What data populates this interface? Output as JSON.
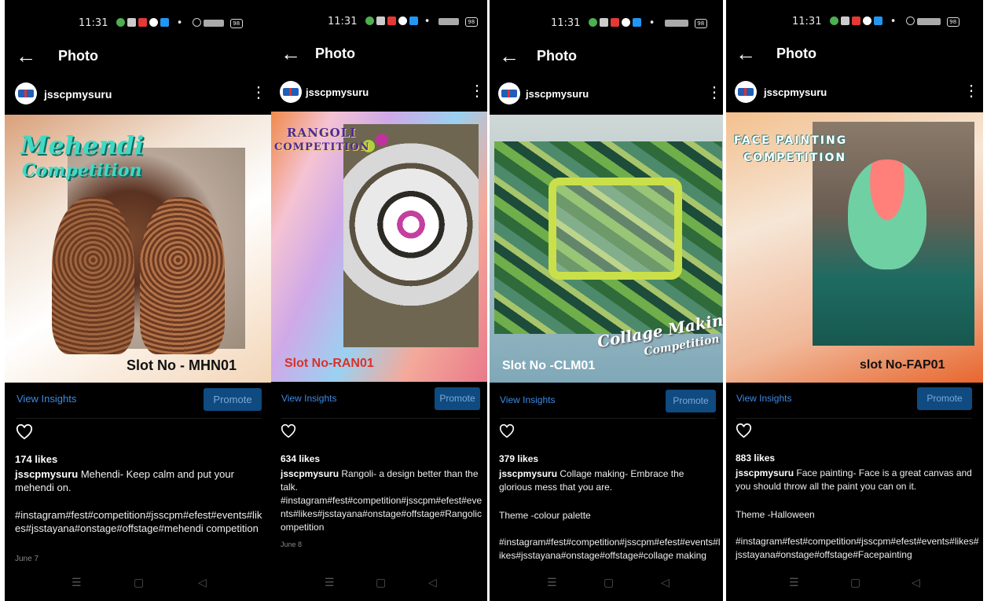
{
  "screens": [
    {
      "time": "11:31",
      "battery": "98",
      "title": "Photo",
      "username": "jsscpmysuru",
      "post_heading_line1": "Mehendi",
      "post_heading_line2": "Competition",
      "slot": "Slot No - MHN01",
      "view_insights": "View Insights",
      "promote": "Promote",
      "likes": "174 likes",
      "caption_user": "jsscpmysuru",
      "caption_text": "Mehendi- Keep calm and put your mehendi on.",
      "theme": "",
      "hashtags": "#instagram#fest#competition#jsscpm#efest#events#likes#jsstayana#onstage#offstage#mehendi competition",
      "date": "June 7"
    },
    {
      "time": "11:31",
      "battery": "98",
      "title": "Photo",
      "username": "jsscpmysuru",
      "post_heading_line1": "Rangoli",
      "post_heading_line2": "competition",
      "slot": "Slot No-RAN01",
      "view_insights": "View Insights",
      "promote": "Promote",
      "likes": "634 likes",
      "caption_user": "jsscpmysuru",
      "caption_text": "Rangoli- a design better than the talk.",
      "theme": "",
      "hashtags": "#instagram#fest#competition#jsscpm#efest#events#likes#jsstayana#onstage#offstage#Rangolicompetition",
      "date": "June 8"
    },
    {
      "time": "11:31",
      "battery": "98",
      "title": "Photo",
      "username": "jsscpmysuru",
      "post_heading_line1": "Collage Making",
      "post_heading_line2": "Competition",
      "slot": "Slot No -CLM01",
      "view_insights": "View Insights",
      "promote": "Promote",
      "likes": "379 likes",
      "caption_user": "jsscpmysuru",
      "caption_text": "Collage making- Embrace the glorious mess that you are.",
      "theme": "Theme -colour palette",
      "hashtags": "#instagram#fest#competition#jsscpm#efest#events#likes#jsstayana#onstage#offstage#collage making",
      "date": ""
    },
    {
      "time": "11:31",
      "battery": "98",
      "title": "Photo",
      "username": "jsscpmysuru",
      "post_heading_line1": "Face painting",
      "post_heading_line2": "competition",
      "slot": "slot No-FAP01",
      "view_insights": "View Insights",
      "promote": "Promote",
      "likes": "883 likes",
      "caption_user": "jsscpmysuru",
      "caption_text": "Face painting- Face is a great canvas and you should throw all the paint you can on it.",
      "theme": "Theme -Halloween",
      "hashtags": "#instagram#fest#competition#jsscpm#efest#events#likes#jsstayana#onstage#offstage#Facepainting",
      "date": ""
    }
  ],
  "icons": {
    "back": "arrow-left-icon",
    "more": "more-vertical-icon",
    "like": "heart-icon",
    "nav": [
      "menu-icon",
      "home-square-icon",
      "back-triangle-icon"
    ]
  },
  "colors": {
    "link": "#3c8be6",
    "promote_bg": "#0f4a80",
    "promote_text": "#7aaad7"
  }
}
